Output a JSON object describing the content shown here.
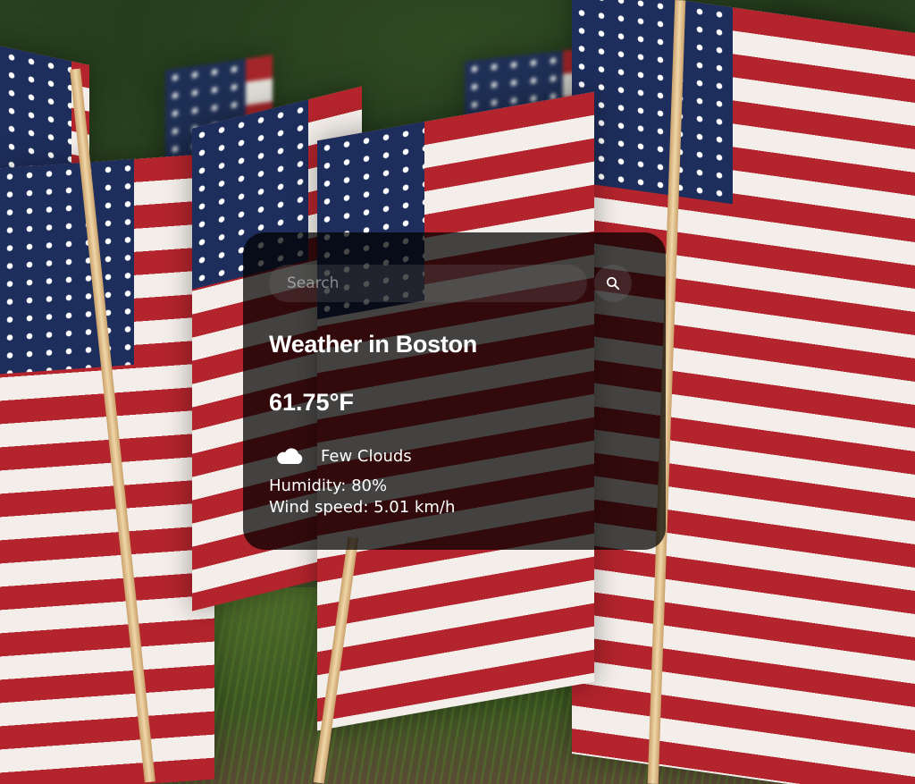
{
  "search": {
    "placeholder": "Search",
    "value": ""
  },
  "icons": {
    "search": "search-icon",
    "weather": "cloud-icon"
  },
  "weather": {
    "city_title": "Weather in Boston",
    "temperature": "61.75°F",
    "description": "Few Clouds",
    "humidity": "Humidity: 80%",
    "wind": "Wind speed: 5.01 km/h"
  },
  "colors": {
    "card_background": "#000000b8",
    "text": "#ffffff",
    "flag_red": "#b3242c",
    "flag_white": "#f3eeea",
    "flag_blue": "#1e2e5c"
  }
}
